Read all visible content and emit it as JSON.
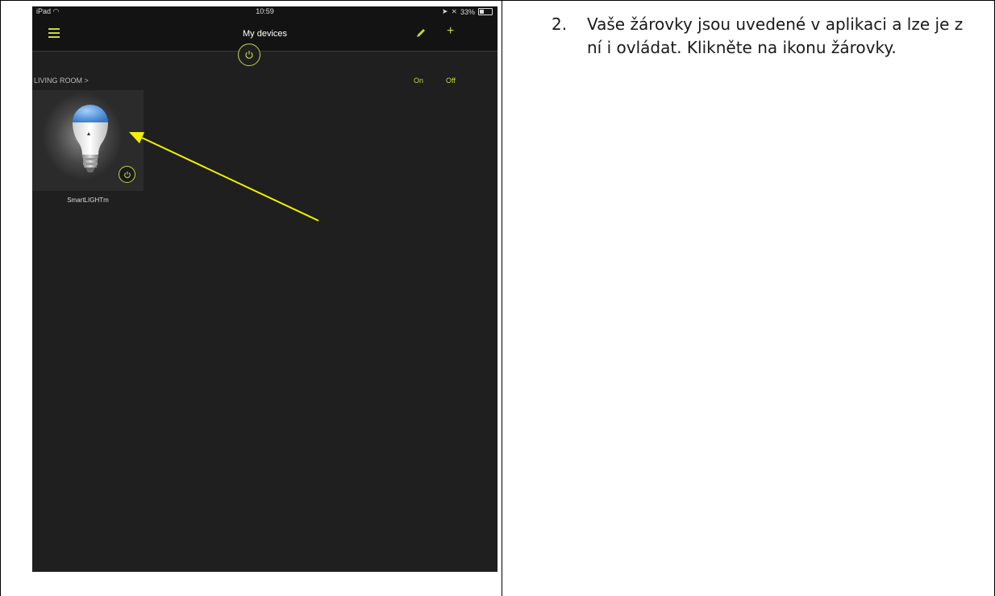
{
  "status_bar": {
    "device": "iPad",
    "time": "10:59",
    "battery": "33%"
  },
  "nav": {
    "title": "My devices"
  },
  "room": {
    "label": "LIVING ROOM  >",
    "on_label": "On",
    "off_label": "Off"
  },
  "devices": [
    {
      "name": "SmartLIGHTm"
    }
  ],
  "instruction": {
    "number": "2.",
    "text": "Vaše žárovky jsou uvedené v aplikaci a lze je z ní i ovládat. Klikněte na ikonu žárovky."
  },
  "colors": {
    "accent": "#c5d740",
    "app_background": "#1f1f1f",
    "arrow": "#f2f200"
  }
}
